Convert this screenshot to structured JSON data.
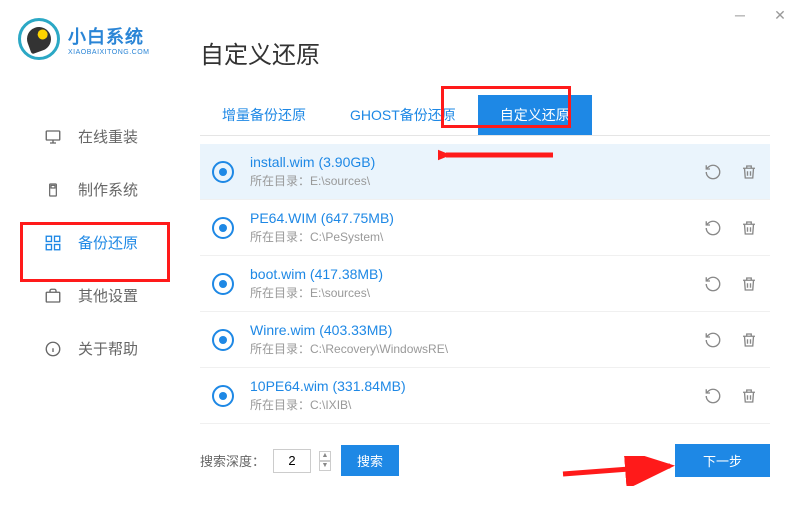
{
  "brand": {
    "title": "小白系统",
    "subtitle": "XIAOBAIXITONG.COM"
  },
  "sidebar": {
    "items": [
      {
        "label": "在线重装",
        "icon": "monitor"
      },
      {
        "label": "制作系统",
        "icon": "usb"
      },
      {
        "label": "备份还原",
        "icon": "grid",
        "active": true
      },
      {
        "label": "其他设置",
        "icon": "briefcase"
      },
      {
        "label": "关于帮助",
        "icon": "info"
      }
    ]
  },
  "page": {
    "title": "自定义还原"
  },
  "tabs": [
    {
      "label": "增量备份还原"
    },
    {
      "label": "GHOST备份还原"
    },
    {
      "label": "自定义还原",
      "active": true
    }
  ],
  "list": {
    "dir_label": "所在目录：",
    "rows": [
      {
        "name": "install.wim",
        "size": "(3.90GB)",
        "dir": "E:\\sources\\",
        "selected": true
      },
      {
        "name": "PE64.WIM",
        "size": "(647.75MB)",
        "dir": "C:\\PeSystem\\"
      },
      {
        "name": "boot.wim",
        "size": "(417.38MB)",
        "dir": "E:\\sources\\"
      },
      {
        "name": "Winre.wim",
        "size": "(403.33MB)",
        "dir": "C:\\Recovery\\WindowsRE\\"
      },
      {
        "name": "10PE64.wim",
        "size": "(331.84MB)",
        "dir": "C:\\IXIB\\"
      }
    ]
  },
  "footer": {
    "search_label": "搜索深度：",
    "depth_value": "2",
    "search_btn": "搜索",
    "next_btn": "下一步"
  }
}
